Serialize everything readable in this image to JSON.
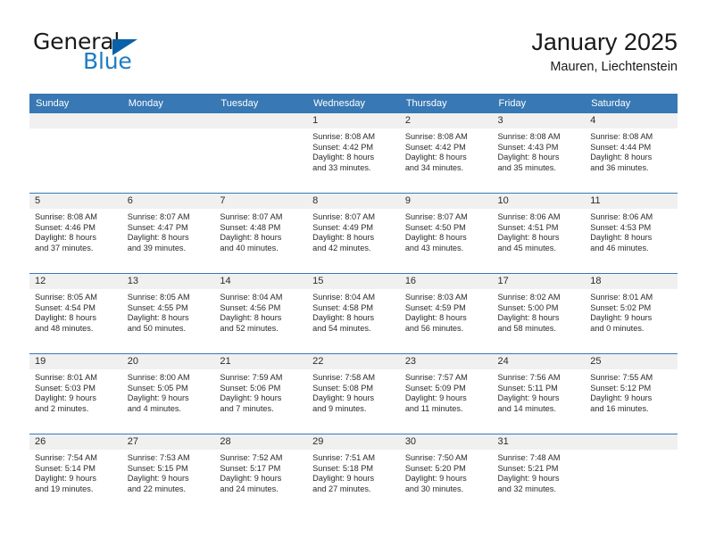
{
  "brand": {
    "name_part1": "General",
    "name_part2": "Blue",
    "logo_icon": "triangle-icon"
  },
  "header": {
    "title": "January 2025",
    "subtitle": "Mauren, Liechtenstein"
  },
  "calendar": {
    "weekday_headers": [
      "Sunday",
      "Monday",
      "Tuesday",
      "Wednesday",
      "Thursday",
      "Friday",
      "Saturday"
    ],
    "accent_color": "#3878b4",
    "datebar_color": "#f0f0f0",
    "weeks": [
      [
        {
          "date": "",
          "empty": true
        },
        {
          "date": "",
          "empty": true
        },
        {
          "date": "",
          "empty": true
        },
        {
          "date": "1",
          "sunrise": "Sunrise: 8:08 AM",
          "sunset": "Sunset: 4:42 PM",
          "daylight1": "Daylight: 8 hours",
          "daylight2": "and 33 minutes."
        },
        {
          "date": "2",
          "sunrise": "Sunrise: 8:08 AM",
          "sunset": "Sunset: 4:42 PM",
          "daylight1": "Daylight: 8 hours",
          "daylight2": "and 34 minutes."
        },
        {
          "date": "3",
          "sunrise": "Sunrise: 8:08 AM",
          "sunset": "Sunset: 4:43 PM",
          "daylight1": "Daylight: 8 hours",
          "daylight2": "and 35 minutes."
        },
        {
          "date": "4",
          "sunrise": "Sunrise: 8:08 AM",
          "sunset": "Sunset: 4:44 PM",
          "daylight1": "Daylight: 8 hours",
          "daylight2": "and 36 minutes."
        }
      ],
      [
        {
          "date": "5",
          "sunrise": "Sunrise: 8:08 AM",
          "sunset": "Sunset: 4:46 PM",
          "daylight1": "Daylight: 8 hours",
          "daylight2": "and 37 minutes."
        },
        {
          "date": "6",
          "sunrise": "Sunrise: 8:07 AM",
          "sunset": "Sunset: 4:47 PM",
          "daylight1": "Daylight: 8 hours",
          "daylight2": "and 39 minutes."
        },
        {
          "date": "7",
          "sunrise": "Sunrise: 8:07 AM",
          "sunset": "Sunset: 4:48 PM",
          "daylight1": "Daylight: 8 hours",
          "daylight2": "and 40 minutes."
        },
        {
          "date": "8",
          "sunrise": "Sunrise: 8:07 AM",
          "sunset": "Sunset: 4:49 PM",
          "daylight1": "Daylight: 8 hours",
          "daylight2": "and 42 minutes."
        },
        {
          "date": "9",
          "sunrise": "Sunrise: 8:07 AM",
          "sunset": "Sunset: 4:50 PM",
          "daylight1": "Daylight: 8 hours",
          "daylight2": "and 43 minutes."
        },
        {
          "date": "10",
          "sunrise": "Sunrise: 8:06 AM",
          "sunset": "Sunset: 4:51 PM",
          "daylight1": "Daylight: 8 hours",
          "daylight2": "and 45 minutes."
        },
        {
          "date": "11",
          "sunrise": "Sunrise: 8:06 AM",
          "sunset": "Sunset: 4:53 PM",
          "daylight1": "Daylight: 8 hours",
          "daylight2": "and 46 minutes."
        }
      ],
      [
        {
          "date": "12",
          "sunrise": "Sunrise: 8:05 AM",
          "sunset": "Sunset: 4:54 PM",
          "daylight1": "Daylight: 8 hours",
          "daylight2": "and 48 minutes."
        },
        {
          "date": "13",
          "sunrise": "Sunrise: 8:05 AM",
          "sunset": "Sunset: 4:55 PM",
          "daylight1": "Daylight: 8 hours",
          "daylight2": "and 50 minutes."
        },
        {
          "date": "14",
          "sunrise": "Sunrise: 8:04 AM",
          "sunset": "Sunset: 4:56 PM",
          "daylight1": "Daylight: 8 hours",
          "daylight2": "and 52 minutes."
        },
        {
          "date": "15",
          "sunrise": "Sunrise: 8:04 AM",
          "sunset": "Sunset: 4:58 PM",
          "daylight1": "Daylight: 8 hours",
          "daylight2": "and 54 minutes."
        },
        {
          "date": "16",
          "sunrise": "Sunrise: 8:03 AM",
          "sunset": "Sunset: 4:59 PM",
          "daylight1": "Daylight: 8 hours",
          "daylight2": "and 56 minutes."
        },
        {
          "date": "17",
          "sunrise": "Sunrise: 8:02 AM",
          "sunset": "Sunset: 5:00 PM",
          "daylight1": "Daylight: 8 hours",
          "daylight2": "and 58 minutes."
        },
        {
          "date": "18",
          "sunrise": "Sunrise: 8:01 AM",
          "sunset": "Sunset: 5:02 PM",
          "daylight1": "Daylight: 9 hours",
          "daylight2": "and 0 minutes."
        }
      ],
      [
        {
          "date": "19",
          "sunrise": "Sunrise: 8:01 AM",
          "sunset": "Sunset: 5:03 PM",
          "daylight1": "Daylight: 9 hours",
          "daylight2": "and 2 minutes."
        },
        {
          "date": "20",
          "sunrise": "Sunrise: 8:00 AM",
          "sunset": "Sunset: 5:05 PM",
          "daylight1": "Daylight: 9 hours",
          "daylight2": "and 4 minutes."
        },
        {
          "date": "21",
          "sunrise": "Sunrise: 7:59 AM",
          "sunset": "Sunset: 5:06 PM",
          "daylight1": "Daylight: 9 hours",
          "daylight2": "and 7 minutes."
        },
        {
          "date": "22",
          "sunrise": "Sunrise: 7:58 AM",
          "sunset": "Sunset: 5:08 PM",
          "daylight1": "Daylight: 9 hours",
          "daylight2": "and 9 minutes."
        },
        {
          "date": "23",
          "sunrise": "Sunrise: 7:57 AM",
          "sunset": "Sunset: 5:09 PM",
          "daylight1": "Daylight: 9 hours",
          "daylight2": "and 11 minutes."
        },
        {
          "date": "24",
          "sunrise": "Sunrise: 7:56 AM",
          "sunset": "Sunset: 5:11 PM",
          "daylight1": "Daylight: 9 hours",
          "daylight2": "and 14 minutes."
        },
        {
          "date": "25",
          "sunrise": "Sunrise: 7:55 AM",
          "sunset": "Sunset: 5:12 PM",
          "daylight1": "Daylight: 9 hours",
          "daylight2": "and 16 minutes."
        }
      ],
      [
        {
          "date": "26",
          "sunrise": "Sunrise: 7:54 AM",
          "sunset": "Sunset: 5:14 PM",
          "daylight1": "Daylight: 9 hours",
          "daylight2": "and 19 minutes."
        },
        {
          "date": "27",
          "sunrise": "Sunrise: 7:53 AM",
          "sunset": "Sunset: 5:15 PM",
          "daylight1": "Daylight: 9 hours",
          "daylight2": "and 22 minutes."
        },
        {
          "date": "28",
          "sunrise": "Sunrise: 7:52 AM",
          "sunset": "Sunset: 5:17 PM",
          "daylight1": "Daylight: 9 hours",
          "daylight2": "and 24 minutes."
        },
        {
          "date": "29",
          "sunrise": "Sunrise: 7:51 AM",
          "sunset": "Sunset: 5:18 PM",
          "daylight1": "Daylight: 9 hours",
          "daylight2": "and 27 minutes."
        },
        {
          "date": "30",
          "sunrise": "Sunrise: 7:50 AM",
          "sunset": "Sunset: 5:20 PM",
          "daylight1": "Daylight: 9 hours",
          "daylight2": "and 30 minutes."
        },
        {
          "date": "31",
          "sunrise": "Sunrise: 7:48 AM",
          "sunset": "Sunset: 5:21 PM",
          "daylight1": "Daylight: 9 hours",
          "daylight2": "and 32 minutes."
        },
        {
          "date": "",
          "empty": true
        }
      ]
    ]
  }
}
